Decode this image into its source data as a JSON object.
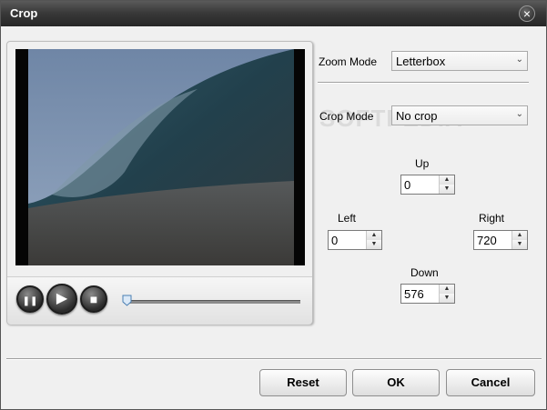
{
  "window": {
    "title": "Crop"
  },
  "watermark": "SOFTPEDIA",
  "player": {
    "pause_glyph": "❚❚",
    "play_glyph": "▶",
    "stop_glyph": "■",
    "progress": 0.0
  },
  "zoom": {
    "label": "Zoom Mode",
    "value": "Letterbox"
  },
  "crop": {
    "label": "Crop Mode",
    "value": "No crop"
  },
  "fields": {
    "up": {
      "label": "Up",
      "value": "0"
    },
    "left": {
      "label": "Left",
      "value": "0"
    },
    "right": {
      "label": "Right",
      "value": "720"
    },
    "down": {
      "label": "Down",
      "value": "576"
    }
  },
  "buttons": {
    "reset": "Reset",
    "ok": "OK",
    "cancel": "Cancel"
  },
  "colors": {
    "titlebar": "#2b2b2b",
    "background": "#f0f0f0"
  }
}
